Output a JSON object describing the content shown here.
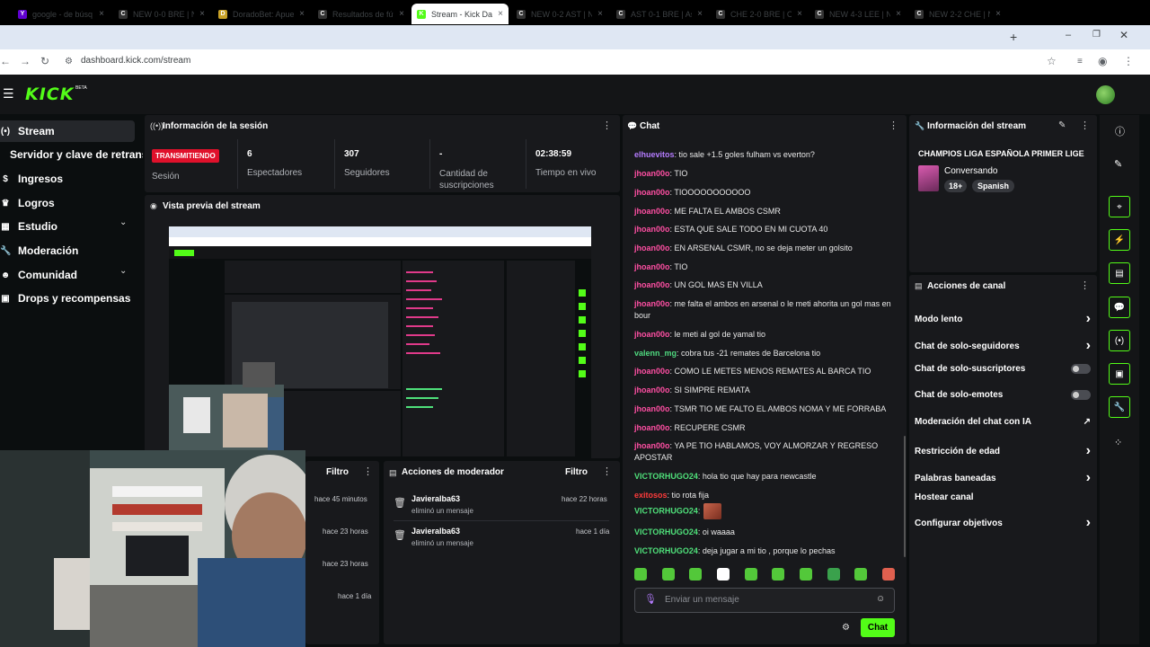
{
  "browser": {
    "tabs": [
      {
        "title": "google - de búsq",
        "favicon": "Y",
        "color": "#6001d2"
      },
      {
        "title": "NEW 0-0 BRE | Ne",
        "favicon": "C",
        "color": "#333"
      },
      {
        "title": "DoradoBet: Apue",
        "favicon": "D",
        "color": "#c9a227"
      },
      {
        "title": "Resultados de fút",
        "favicon": "C",
        "color": "#333"
      },
      {
        "title": "Stream - Kick Das",
        "favicon": "K",
        "color": "#53fc18"
      },
      {
        "title": "NEW 0-2 AST | Ne",
        "favicon": "C",
        "color": "#333"
      },
      {
        "title": "AST 0-1 BRE | Asto",
        "favicon": "C",
        "color": "#333"
      },
      {
        "title": "CHE 2-0 BRE | Che",
        "favicon": "C",
        "color": "#333"
      },
      {
        "title": "NEW 4-3 LEE | Ne",
        "favicon": "C",
        "color": "#333"
      },
      {
        "title": "NEW 2-2 CHE | Ne",
        "favicon": "C",
        "color": "#333"
      }
    ],
    "url": "dashboard.kick.com/stream"
  },
  "app": {
    "logo": "KICK",
    "logo_badge": "BETA"
  },
  "sidebar": {
    "items": [
      {
        "label": "Stream",
        "icon": "broadcast-icon"
      },
      {
        "label": "Servidor y clave de retransmisión",
        "icon": ""
      },
      {
        "label": "Ingresos",
        "icon": "money-icon"
      },
      {
        "label": "Logros",
        "icon": "trophy-icon"
      },
      {
        "label": "Estudio",
        "icon": "studio-icon"
      },
      {
        "label": "Moderación",
        "icon": "wrench-icon"
      },
      {
        "label": "Comunidad",
        "icon": "people-icon"
      },
      {
        "label": "Drops y recompensas",
        "icon": "gift-icon"
      }
    ]
  },
  "session": {
    "title": "Información de la sesión",
    "status": "TRANSMITIENDO",
    "status_label": "Sesión",
    "viewers": "6",
    "viewers_label": "Espectadores",
    "followers": "307",
    "followers_label": "Seguidores",
    "subs": "-",
    "subs_label": "Cantidad de suscripciones",
    "time": "02:38:59",
    "time_label": "Tiempo en vivo"
  },
  "preview": {
    "title": "Vista previa del stream"
  },
  "activity": {
    "filter": "Filtro",
    "times": [
      "hace 45 minutos",
      "hace 23 horas",
      "hace 23 horas",
      "hace 1 día"
    ]
  },
  "mod_actions": {
    "title": "Acciones de moderador",
    "filter": "Filtro",
    "rows": [
      {
        "user": "Javieralba63",
        "action": "eliminó un mensaje",
        "time": "hace 22 horas"
      },
      {
        "user": "Javieralba63",
        "action": "eliminó un mensaje",
        "time": "hace 1 día"
      }
    ]
  },
  "chat": {
    "title": "Chat",
    "messages": [
      {
        "user": "elhuevitos",
        "color": "#b57cff",
        "text": ": tio sale +1.5 goles fulham vs everton?"
      },
      {
        "user": "jhoan00o",
        "color": "#ff4fa3",
        "text": ": TIO"
      },
      {
        "user": "jhoan00o",
        "color": "#ff4fa3",
        "text": ": TIOOOOOOOOOOO"
      },
      {
        "user": "jhoan00o",
        "color": "#ff4fa3",
        "text": ": ME FALTA EL AMBOS CSMR"
      },
      {
        "user": "jhoan00o",
        "color": "#ff4fa3",
        "text": ": ESTA QUE SALE TODO EN MI CUOTA 40"
      },
      {
        "user": "jhoan00o",
        "color": "#ff4fa3",
        "text": ": EN ARSENAL CSMR, no se deja meter un golsito"
      },
      {
        "user": "jhoan00o",
        "color": "#ff4fa3",
        "text": ": TIO"
      },
      {
        "user": "jhoan00o",
        "color": "#ff4fa3",
        "text": ": UN GOL MAS EN VILLA"
      },
      {
        "user": "jhoan00o",
        "color": "#ff4fa3",
        "text": ": me falta el ambos en arsenal o le meti ahorita un gol mas en bour"
      },
      {
        "user": "jhoan00o",
        "color": "#ff4fa3",
        "text": ": le meti al gol de yamal tio"
      },
      {
        "user": "valenn_mg",
        "color": "#4fd97f",
        "text": ": cobra tus -21 remates de Barcelona tio"
      },
      {
        "user": "jhoan00o",
        "color": "#ff4fa3",
        "text": ": COMO LE METES MENOS REMATES AL BARCA TIO"
      },
      {
        "user": "jhoan00o",
        "color": "#ff4fa3",
        "text": ": SI SIMPRE REMATA"
      },
      {
        "user": "jhoan00o",
        "color": "#ff4fa3",
        "text": ": TSMR TIO ME FALTO EL AMBOS NOMA Y ME FORRABA"
      },
      {
        "user": "jhoan00o",
        "color": "#ff4fa3",
        "text": ": RECUPERE CSMR"
      },
      {
        "user": "jhoan00o",
        "color": "#ff4fa3",
        "text": ": YA PE TIO HABLAMOS, VOY ALMORZAR Y REGRESO APOSTAR"
      },
      {
        "user": "VICTORHUGO24",
        "color": "#4fe07a",
        "text": ": hola tio que hay para newcastle"
      },
      {
        "user": "exitosos",
        "color": "#ff3b3b",
        "text": ": tio rota fija"
      },
      {
        "user": "VICTORHUGO24",
        "color": "#4fe07a",
        "text": ":"
      },
      {
        "user": "VICTORHUGO24",
        "color": "#4fe07a",
        "text": ": oi waaaa"
      },
      {
        "user": "VICTORHUGO24",
        "color": "#4fe07a",
        "text": ": deja jugar a mi tio , porque lo pechas"
      }
    ],
    "input_placeholder": "Enviar un mensaje",
    "send_label": "Chat"
  },
  "stream_info": {
    "title": "Información del stream",
    "stream_title": "CHAMPIOS LIGA ESPAÑOLA PRIMER LIGE",
    "category": "Conversando",
    "tags": [
      "18+",
      "Spanish"
    ]
  },
  "channel_actions": {
    "title": "Acciones de canal",
    "items": [
      {
        "label": "Modo lento",
        "kind": "chevron"
      },
      {
        "label": "Chat de solo-seguidores",
        "kind": "chevron"
      },
      {
        "label": "Chat de solo-suscriptores",
        "kind": "toggle"
      },
      {
        "label": "Chat de solo-emotes",
        "kind": "toggle"
      },
      {
        "label": "Moderación del chat con IA",
        "kind": "external"
      },
      {
        "label": "Restricción de edad",
        "kind": "chevron"
      },
      {
        "label": "Palabras baneadas",
        "kind": "chevron"
      },
      {
        "label": "Hostear canal",
        "kind": "none"
      },
      {
        "label": "Configurar objetivos",
        "kind": "chevron"
      }
    ]
  }
}
